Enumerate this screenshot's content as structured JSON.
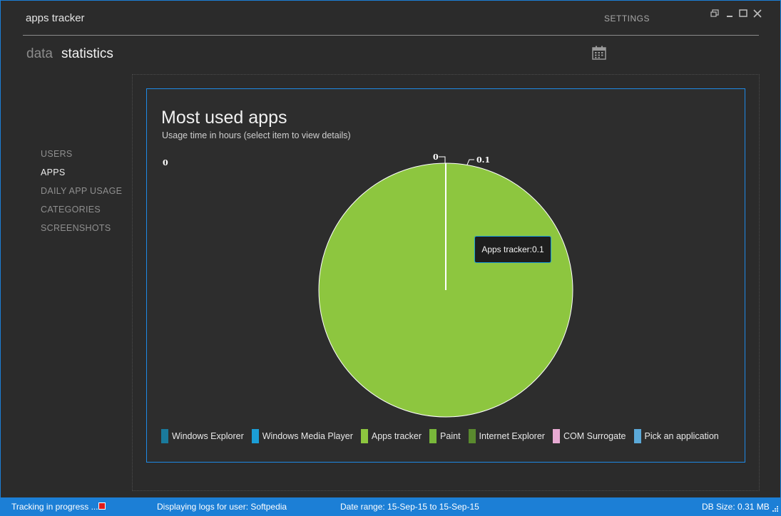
{
  "app": {
    "title": "apps tracker",
    "settings_label": "SETTINGS",
    "window_controls": [
      "restore-icon",
      "minimize-icon",
      "maximize-icon",
      "close-icon"
    ]
  },
  "tabs": {
    "data_label": "data",
    "statistics_label": "statistics",
    "calendar_icon": "calendar-icon"
  },
  "nav": {
    "items": [
      {
        "label": "USERS",
        "active": false
      },
      {
        "label": "APPS",
        "active": true
      },
      {
        "label": "DAILY APP USAGE",
        "active": false
      },
      {
        "label": "CATEGORIES",
        "active": false
      },
      {
        "label": "SCREENSHOTS",
        "active": false
      }
    ]
  },
  "chart_data": {
    "type": "pie",
    "title": "Most used apps",
    "subtitle": "Usage time in hours (select item to view details)",
    "axis_value_label": "0",
    "slices": [
      {
        "name": "Windows Explorer",
        "value": 0,
        "color": "#1a7a9c"
      },
      {
        "name": "Windows Media Player",
        "value": 0,
        "color": "#1b9ed6"
      },
      {
        "name": "Apps tracker",
        "value": 0.1,
        "color": "#8dc63f"
      },
      {
        "name": "Paint",
        "value": 0,
        "color": "#79b83a"
      },
      {
        "name": "Internet Explorer",
        "value": 0,
        "color": "#5a8a2e"
      },
      {
        "name": "COM Surrogate",
        "value": 0,
        "color": "#e7a9d2"
      },
      {
        "name": "Pick an application",
        "value": 0,
        "color": "#5ba9d9"
      }
    ],
    "data_labels": [
      "0",
      "0.1"
    ],
    "tooltip": "Apps tracker:0.1",
    "legend_placement": "bottom"
  },
  "status": {
    "tracking": "Tracking in progress ...",
    "user": "Displaying logs for user: Softpedia",
    "date_range": "Date range: 15-Sep-15 to 15-Sep-15",
    "db_size": "DB Size: 0.31 MB",
    "record_color": "#e01a1a"
  }
}
